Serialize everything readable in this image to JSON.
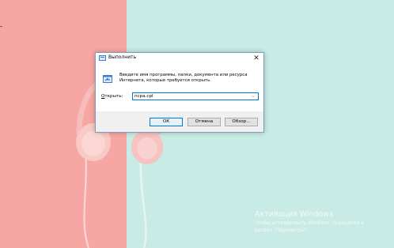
{
  "dialog": {
    "title": "Выполнить",
    "close_symbol": "✕",
    "description_line1": "Введите имя программы, папки, документа или ресурса",
    "description_line2": "Интернета, которые требуется открыть.",
    "open_label_accel": "О",
    "open_label_rest": "ткрыть:",
    "open_value": "ncpa.cpl",
    "combo_arrow": "⌵",
    "buttons": {
      "ok": "ОК",
      "cancel": "Отмена",
      "browse": "Обзор..."
    }
  },
  "watermark": {
    "title": "Активация Windows",
    "line1": "Чтобы активировать Windows, перейдите в",
    "line2": "раздел \"Параметры\"."
  },
  "icons": {
    "title_icon": "run-dialog-icon",
    "run_icon": "run-program-icon",
    "close_icon": "close-icon",
    "dropdown_icon": "chevron-down-icon"
  },
  "colors": {
    "wallpaper_left": "#f6a7a3",
    "wallpaper_right": "#c9ebe5",
    "accent": "#0078d7"
  }
}
